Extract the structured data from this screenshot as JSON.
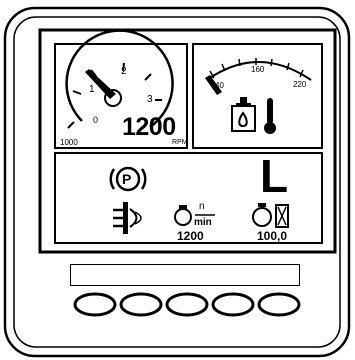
{
  "rpm_gauge": {
    "tick_labels": [
      "1",
      "2",
      "3",
      "0"
    ],
    "scale_note": "1000",
    "value": "1200",
    "unit": "RPM",
    "needle_fraction": 0.2
  },
  "temp_gauge": {
    "tick_labels": [
      "40",
      "160",
      "220"
    ],
    "needle_fraction": 0.0,
    "icons": [
      "coolant-tank-icon",
      "thermometer-icon"
    ]
  },
  "status_panel": {
    "parking_brake_symbol": "P",
    "gear": "L",
    "rpm_unit_top": "n",
    "rpm_unit_bottom": "min",
    "rpm_value": "1200",
    "hours_value": "100,0",
    "icons": [
      "parking-brake-icon",
      "headlight-icon",
      "engine-speed-icon",
      "engine-hours-icon"
    ]
  },
  "softkeys": {
    "label_strip_text": "",
    "button_count": 5
  }
}
